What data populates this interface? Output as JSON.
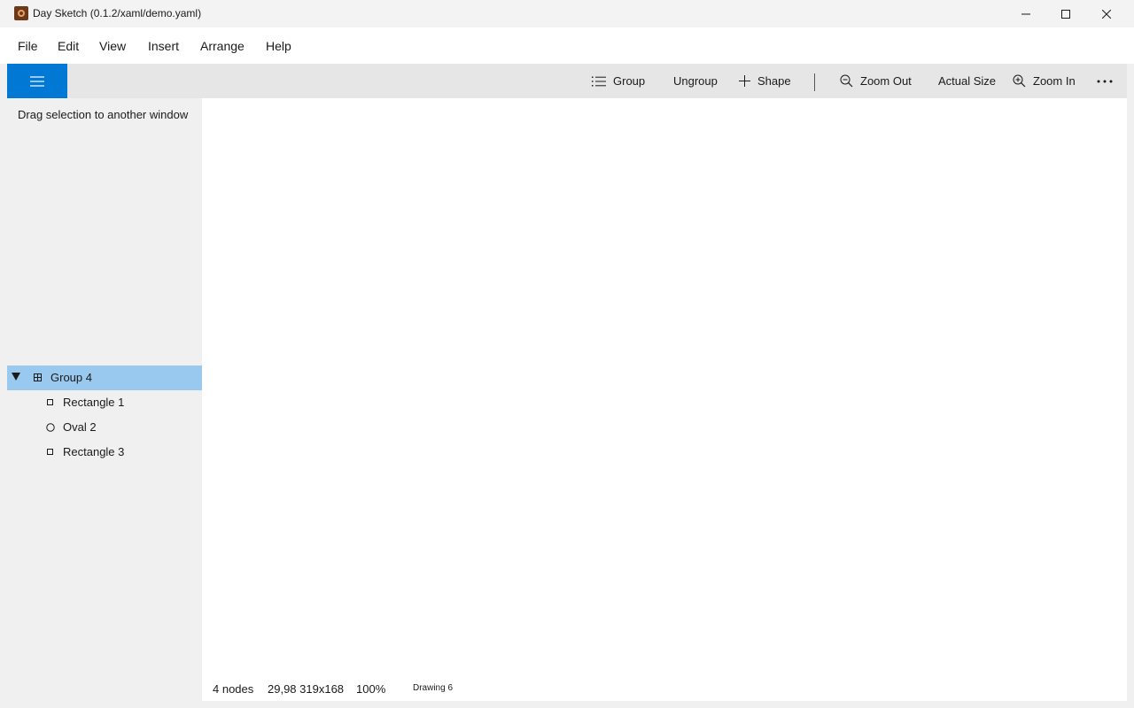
{
  "window": {
    "title": "Day Sketch (0.1.2/xaml/demo.yaml)",
    "app_icon": "app-icon",
    "controls": [
      "minimize-icon",
      "maximize-icon",
      "close-icon"
    ]
  },
  "menu": {
    "file": "File",
    "edit": "Edit",
    "view": "View",
    "insert": "Insert",
    "arrange": "Arrange",
    "help": "Help"
  },
  "toolbar": {
    "menu_icon": "hamburger-icon",
    "group": "Group",
    "ungroup": "Ungroup",
    "shape": "Shape",
    "zoom_out": "Zoom Out",
    "actual_size": "Actual Size",
    "zoom_in": "Zoom In",
    "more_icon": "more-icon",
    "accent_color": "#0078d4"
  },
  "sidebar": {
    "hint": "Drag selection to another window",
    "tree": [
      {
        "label": "Group 4",
        "icon": "group-icon",
        "selected": true,
        "expanded": true
      },
      {
        "label": "Rectangle 1",
        "icon": "rectangle-icon"
      },
      {
        "label": "Oval 2",
        "icon": "oval-icon"
      },
      {
        "label": "Rectangle 3",
        "icon": "rectangle-icon"
      }
    ],
    "selection_color": "#99c9ef"
  },
  "status": {
    "nodes": "4 nodes",
    "bounds": "29,98 319x168",
    "zoom": "100%",
    "drawing": "Drawing 6"
  }
}
